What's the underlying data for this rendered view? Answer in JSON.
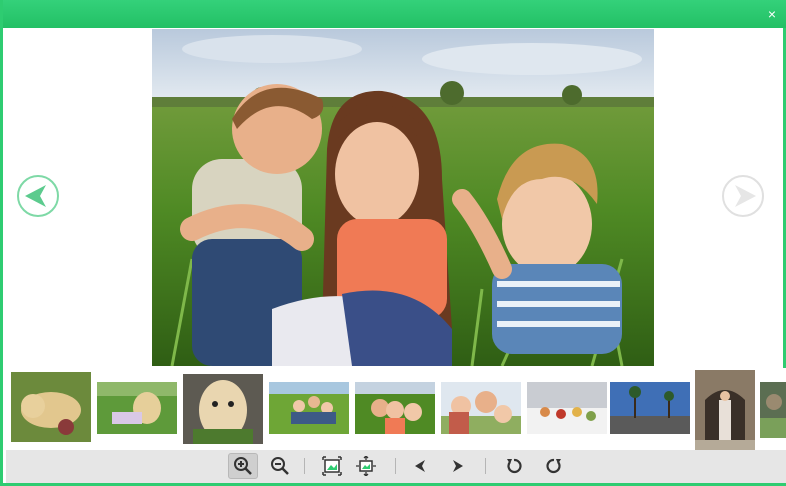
{
  "window": {
    "accent_color": "#2ecc71",
    "close_label": "×"
  },
  "viewer": {
    "current_image": "children-in-grass-field",
    "prev_icon": "arrow-left-circle-icon",
    "next_icon": "arrow-right-circle-icon"
  },
  "filmstrip": {
    "thumbnails": [
      "dog-lying-on-grass",
      "dog-and-child-on-lawn",
      "puppy-portrait",
      "children-sitting-on-grass",
      "children-in-grass",
      "children-hugging",
      "food-table-event",
      "palm-tree-road",
      "woman-at-archway",
      "partial-thumbnail"
    ]
  },
  "toolbar": {
    "buttons": [
      "zoom-in-icon",
      "zoom-out-icon",
      "fit-to-window-icon",
      "actual-size-icon",
      "previous-icon",
      "next-icon",
      "rotate-left-icon",
      "rotate-right-icon"
    ]
  }
}
